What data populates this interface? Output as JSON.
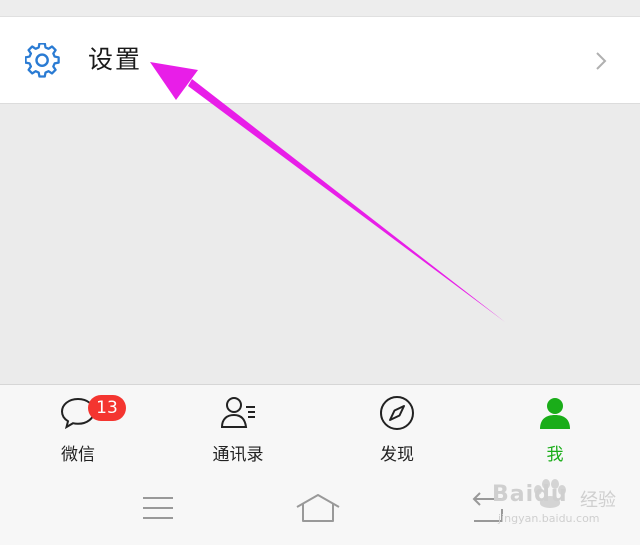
{
  "settings_row": {
    "label": "设置",
    "icon": "gear-icon",
    "chevron": "chevron-right-icon"
  },
  "colors": {
    "accent_green": "#1aad19",
    "badge_red": "#f43530",
    "icon_blue": "#2a7bd3",
    "arrow_magenta": "#e81ee8"
  },
  "tabs": [
    {
      "label": "微信",
      "icon": "chat-bubble-icon",
      "badge": "13"
    },
    {
      "label": "通讯录",
      "icon": "contacts-icon"
    },
    {
      "label": "发现",
      "icon": "compass-icon"
    },
    {
      "label": "我",
      "icon": "person-icon",
      "active": true
    }
  ],
  "system_nav": {
    "menu": "menu-icon",
    "home": "home-icon",
    "back": "back-icon"
  },
  "watermark": {
    "brand": "Baidu",
    "suffix": "经验",
    "url": "jingyan.baidu.com"
  }
}
